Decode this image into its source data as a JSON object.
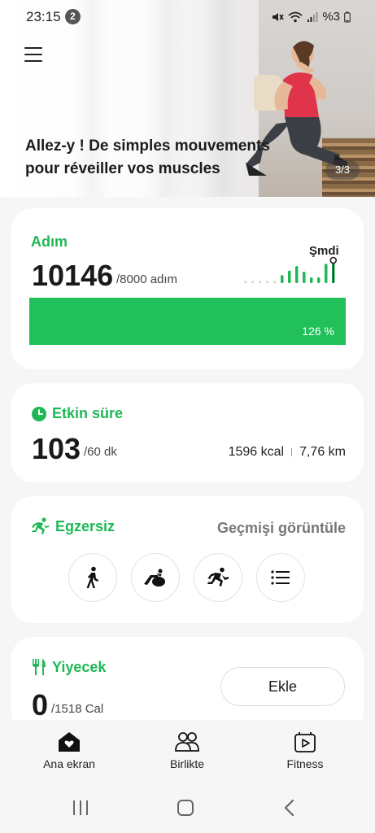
{
  "status_bar": {
    "time": "23:15",
    "notification_count": "2",
    "battery": "%3"
  },
  "hero": {
    "title": "Allez-y ! De simples mouvements pour réveiller vos muscles",
    "pager": "3/3"
  },
  "steps": {
    "title": "Adım",
    "count": "10146",
    "goal": "/8000 adım",
    "now_label": "Şmdi",
    "progress_percent": 126,
    "progress_label": "126 %",
    "hourly_levels": [
      0.1,
      0.1,
      0.1,
      0.1,
      0.1,
      0.35,
      0.55,
      0.75,
      0.5,
      0.25,
      0.25,
      0.85,
      0.9
    ]
  },
  "active_time": {
    "title": "Etkin süre",
    "value": "103",
    "goal": "/60 dk",
    "calories": "1596 kcal",
    "distance": "7,76 km"
  },
  "exercise": {
    "title": "Egzersiz",
    "history_link": "Geçmişi görüntüle",
    "buttons": [
      "walking-icon",
      "yoga-ball-icon",
      "running-icon",
      "list-icon"
    ]
  },
  "food": {
    "title": "Yiyecek",
    "value": "0",
    "goal": "/1518 Cal",
    "add_label": "Ekle"
  },
  "bottom_nav": {
    "items": [
      {
        "label": "Ana ekran",
        "icon": "home-heart-icon"
      },
      {
        "label": "Birlikte",
        "icon": "people-icon"
      },
      {
        "label": "Fitness",
        "icon": "fitness-video-icon"
      }
    ]
  },
  "colors": {
    "accent": "#1fb856",
    "progress_fill": "#21c05b"
  }
}
